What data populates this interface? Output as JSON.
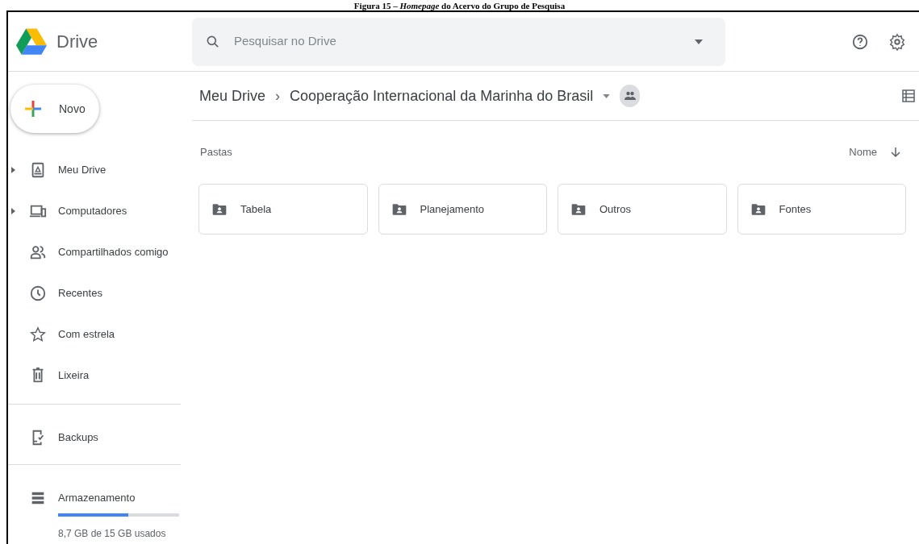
{
  "caption": "Figura 15 – *Homepage* do Acervo do Grupo de Pesquisa",
  "header": {
    "app_name": "Drive",
    "search": {
      "placeholder": "Pesquisar no Drive"
    }
  },
  "new_button": {
    "label": "Novo"
  },
  "sidebar": {
    "groups": [
      {
        "items": [
          {
            "label": "Meu Drive",
            "expandable": true
          },
          {
            "label": "Computadores",
            "expandable": true
          },
          {
            "label": "Compartilhados comigo",
            "expandable": false
          },
          {
            "label": "Recentes",
            "expandable": false
          },
          {
            "label": "Com estrela",
            "expandable": false
          },
          {
            "label": "Lixeira",
            "expandable": false
          }
        ]
      },
      {
        "items": [
          {
            "label": "Backups",
            "expandable": false
          }
        ]
      },
      {
        "items": [
          {
            "label": "Armazenamento",
            "expandable": false
          }
        ]
      }
    ]
  },
  "storage": {
    "level": 0.58,
    "usage": "8,7 GB de 15 GB usados"
  },
  "breadcrumb": {
    "root": "Meu Drive",
    "separator": "›",
    "current": "Cooperação Internacional da Marinha do Brasil"
  },
  "section_title": "Pastas",
  "sort": {
    "label": "Nome"
  },
  "folders": [
    {
      "name": "Tabela"
    },
    {
      "name": "Planejamento"
    },
    {
      "name": "Outros"
    },
    {
      "name": "Fontes"
    }
  ]
}
